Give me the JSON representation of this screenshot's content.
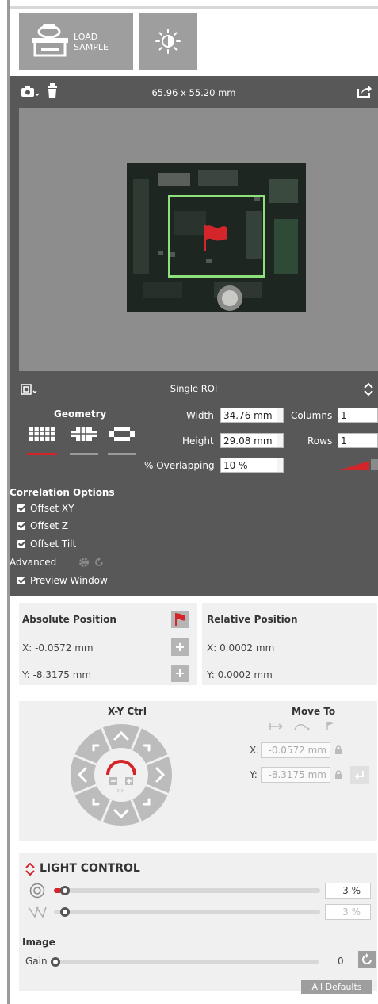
{
  "header": {
    "load_sample_line1": "LOAD",
    "load_sample_line2": "SAMPLE"
  },
  "viewer": {
    "dimensions": "65.96 x 55.20 mm"
  },
  "roi": {
    "mode": "Single ROI",
    "geometry_label": "Geometry",
    "width_label": "Width",
    "width_value": "34.76 mm",
    "height_label": "Height",
    "height_value": "29.08 mm",
    "overlap_label": "% Overlapping",
    "overlap_value": "10 %",
    "columns_label": "Columns",
    "columns_value": "1",
    "rows_label": "Rows",
    "rows_value": "1"
  },
  "correlation": {
    "title": "Correlation Options",
    "offset_xy": "Offset XY",
    "offset_z": "Offset Z",
    "offset_tilt": "Offset Tilt",
    "advanced": "Advanced",
    "preview_window": "Preview Window"
  },
  "absolute_position": {
    "title": "Absolute Position",
    "x": "X: -0.0572 mm",
    "y": "Y: -8.3175 mm"
  },
  "relative_position": {
    "title": "Relative Position",
    "x": "X: 0.0002 mm",
    "y": "Y: 0.0002 mm"
  },
  "xy_ctrl": {
    "title": "X-Y Ctrl"
  },
  "move_to": {
    "title": "Move To",
    "x_label": "X:",
    "x_value": "-0.0572 mm",
    "y_label": "Y:",
    "y_value": "-8.3175 mm"
  },
  "light_control": {
    "title": "LIGHT CONTROL",
    "light1_value": "3 %",
    "light1_level": 3,
    "light2_value": "3 %",
    "light2_level": 3,
    "image_title": "Image",
    "gain_label": "Gain",
    "gain_value": "0",
    "all_defaults": "All Defaults"
  },
  "colors": {
    "accent_red": "#d4252b",
    "roi_green": "#8ee07a",
    "panel_dark": "#585858"
  }
}
